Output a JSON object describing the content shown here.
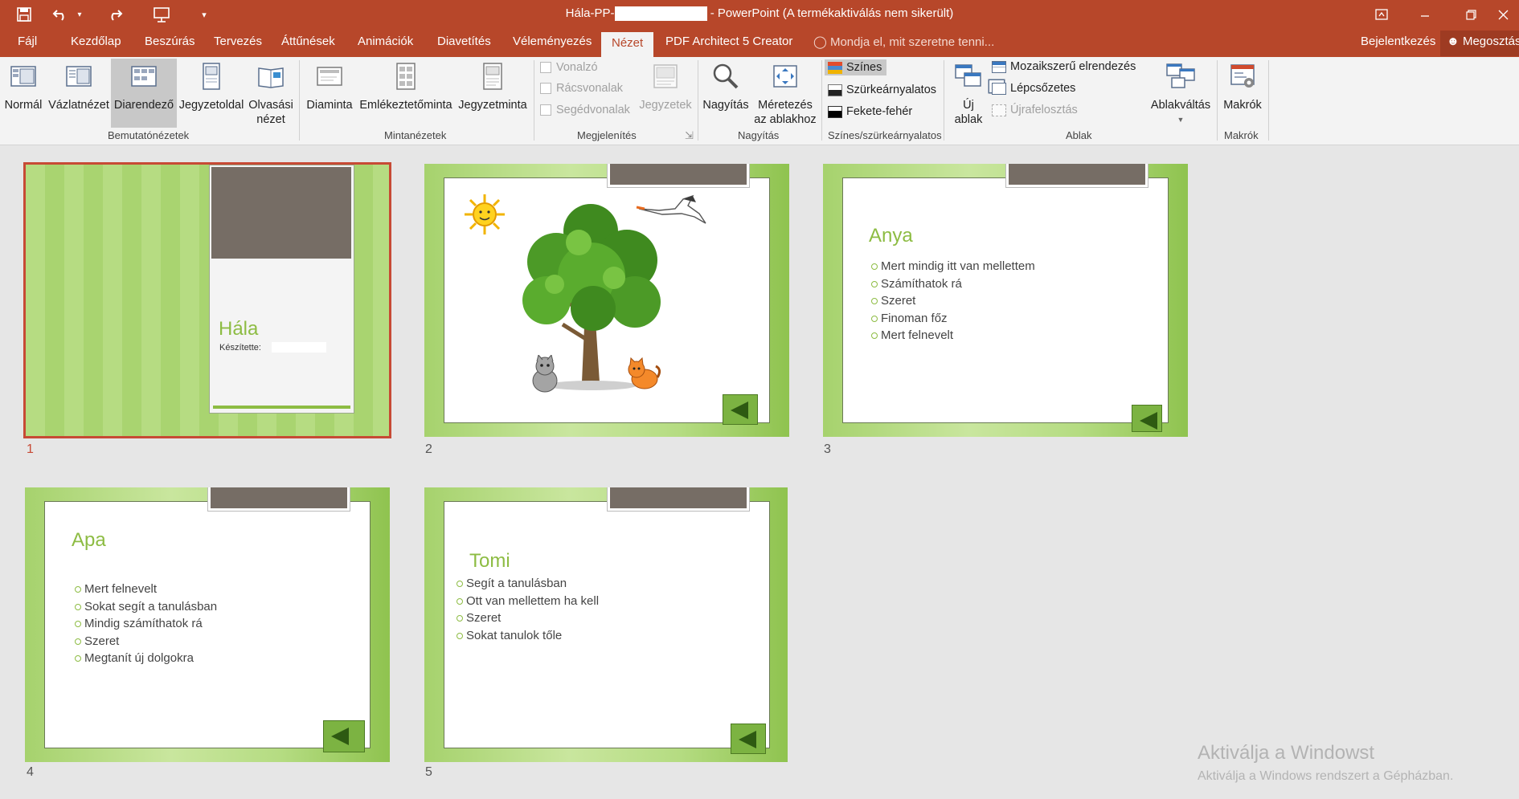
{
  "window": {
    "title_prefix": "Hála-PP-",
    "title_suffix": "- PowerPoint (A termékaktiválás nem sikerült)"
  },
  "tabs": [
    {
      "label": "Fájl"
    },
    {
      "label": "Kezdőlap"
    },
    {
      "label": "Beszúrás"
    },
    {
      "label": "Tervezés"
    },
    {
      "label": "Áttűnések"
    },
    {
      "label": "Animációk"
    },
    {
      "label": "Diavetítés"
    },
    {
      "label": "Véleményezés"
    },
    {
      "label": "Nézet"
    },
    {
      "label": "PDF Architect 5 Creator"
    }
  ],
  "tellme": "Mondja el, mit szeretne tenni...",
  "signin": "Bejelentkezés",
  "share": "Megosztás",
  "ribbon": {
    "presentation_views": {
      "label": "Bemutatónézetek",
      "normal": "Normál",
      "outline": "Vázlatnézet",
      "sorter": "Diarendező",
      "notes_page": "Jegyzetoldal",
      "reading_1": "Olvasási",
      "reading_2": "nézet"
    },
    "master_views": {
      "label": "Mintanézetek",
      "slide_master": "Diaminta",
      "handout_master": "Emlékeztetőminta",
      "notes_master": "Jegyzetminta"
    },
    "show": {
      "label": "Megjelenítés",
      "ruler": "Vonalzó",
      "gridlines": "Rácsvonalak",
      "guides": "Segédvonalak",
      "notes": "Jegyzetek"
    },
    "zoom": {
      "label": "Nagyítás",
      "zoom": "Nagyítás",
      "fit_1": "Méretezés",
      "fit_2": "az ablakhoz"
    },
    "color": {
      "label": "Színes/szürkeárnyalatos",
      "color": "Színes",
      "grayscale": "Szürkeárnyalatos",
      "bw": "Fekete-fehér"
    },
    "window": {
      "label": "Ablak",
      "new_1": "Új",
      "new_2": "ablak",
      "arrange_all": "Mozaikszerű elrendezés",
      "cascade": "Lépcsőzetes",
      "move_split": "Újrafelosztás",
      "switch": "Ablakváltás"
    },
    "macros": {
      "label": "Makrók",
      "macros": "Makrók"
    }
  },
  "slides": [
    {
      "number": "1",
      "title": "Hála",
      "subtitle": "Készítette:"
    },
    {
      "number": "2"
    },
    {
      "number": "3",
      "title": "Anya",
      "bullets": [
        "Mert mindig itt van mellettem",
        "Számíthatok rá",
        "Szeret",
        "Finoman főz",
        "Mert felnevelt"
      ]
    },
    {
      "number": "4",
      "title": "Apa",
      "bullets": [
        "Mert felnevelt",
        "Sokat segít a tanulásban",
        "Mindig számíthatok rá",
        "Szeret",
        "Megtanít  új dolgokra"
      ]
    },
    {
      "number": "5",
      "title": "Tomi",
      "bullets": [
        "Segít a tanulásban",
        "Ott van mellettem ha kell",
        "Szeret",
        "Sokat tanulok tőle"
      ]
    }
  ],
  "watermark": {
    "line1": "Aktiválja a Windowst",
    "line2": "Aktiválja a Windows rendszert a Gépházban."
  }
}
